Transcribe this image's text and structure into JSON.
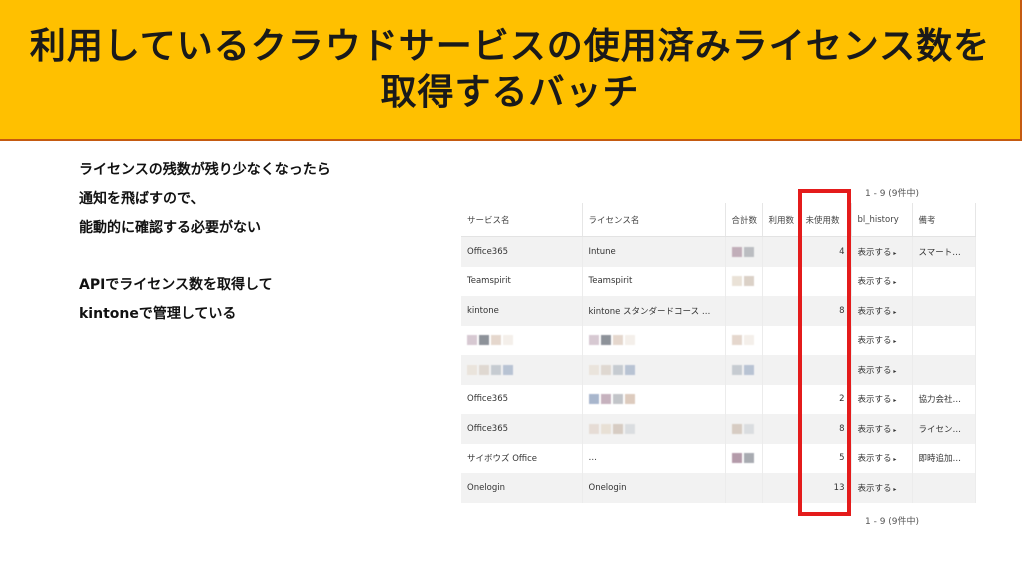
{
  "banner": {
    "line1": "利用しているクラウドサービスの使用済みライセンス数を",
    "line2": "取得するバッチ"
  },
  "description": {
    "lines_a": [
      "ライセンスの残数が残り少なくなったら",
      "通知を飛ばすので、",
      "能動的に確認する必要がない"
    ],
    "lines_b": [
      "APIでライセンス数を取得して",
      "kintoneで管理している"
    ]
  },
  "table": {
    "pager": "1 - 9 (9件中)",
    "headers": [
      "サービス名",
      "ライセンス名",
      "合計数",
      "利用数",
      "未使用数",
      "bl_history",
      "備考"
    ],
    "rows": [
      {
        "service": "Office365",
        "license": "Intune",
        "unused": "4",
        "history": "表示する",
        "note": "スマート…"
      },
      {
        "service": "Teamspirit",
        "license": "Teamspirit",
        "unused": "",
        "history": "表示する",
        "note": ""
      },
      {
        "service": "kintone",
        "license": "kintone スタンダードコース 月…",
        "unused": "8",
        "history": "表示する",
        "note": ""
      },
      {
        "service": "",
        "license": "",
        "unused": "",
        "history": "表示する",
        "note": ""
      },
      {
        "service": "",
        "license": "",
        "unused": "",
        "history": "表示する",
        "note": ""
      },
      {
        "service": "Office365",
        "license": "",
        "unused": "2",
        "history": "表示する",
        "note": "協力会社…"
      },
      {
        "service": "Office365",
        "license": "",
        "unused": "8",
        "history": "表示する",
        "note": "ライセン…"
      },
      {
        "service": "サイボウズ Office",
        "license": "…",
        "unused": "5",
        "history": "表示する",
        "note": "即時追加…"
      },
      {
        "service": "Onelogin",
        "license": "Onelogin",
        "unused": "13",
        "history": "表示する",
        "note": ""
      }
    ]
  },
  "colors": {
    "banner": "#ffc000",
    "banner_border": "#c55a11",
    "highlight": "#e41b1b"
  }
}
